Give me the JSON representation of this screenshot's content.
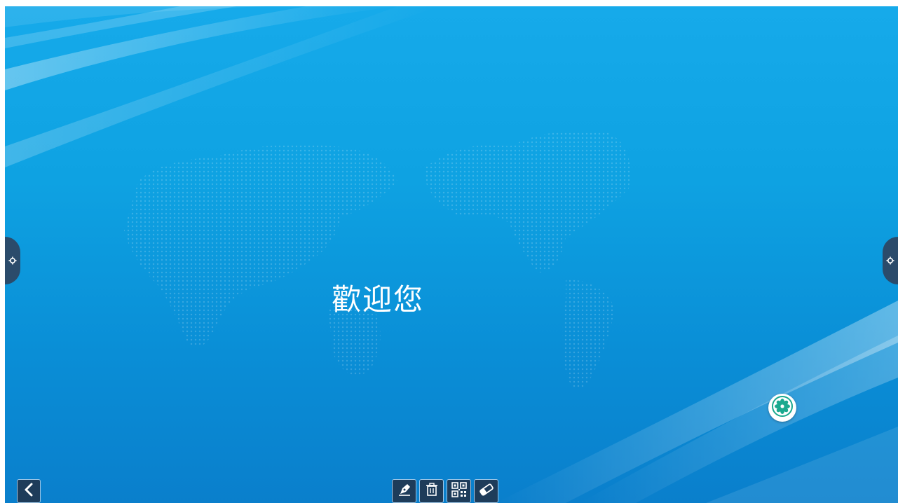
{
  "screen": {
    "welcome_text": "歡迎您",
    "colors": {
      "background_top": "#16aaea",
      "background_bottom": "#0a7fcc",
      "panel_dark": "#1e3c5a",
      "accent_green": "#1aa98e"
    }
  },
  "left_tab": {
    "icon": "gear-icon"
  },
  "right_tab": {
    "icon": "gear-icon"
  },
  "floating_button": {
    "icon": "flower-icon"
  },
  "back_button": {
    "icon": "chevron-left-icon"
  },
  "toolbar": {
    "items": [
      {
        "icon": "pen-icon"
      },
      {
        "icon": "trash-icon"
      },
      {
        "icon": "qr-code-icon"
      },
      {
        "icon": "eraser-icon"
      }
    ]
  }
}
